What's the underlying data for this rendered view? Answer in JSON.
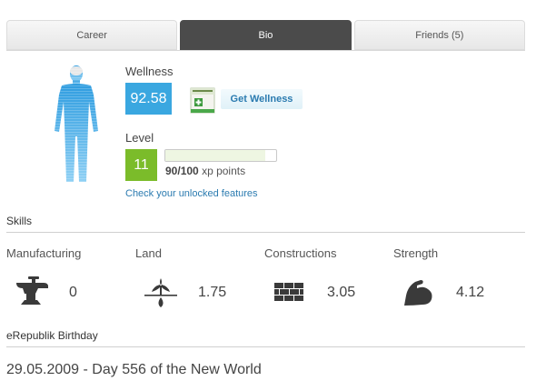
{
  "tabs": [
    "Career",
    "Bio",
    "Friends (5)"
  ],
  "active_tab": "Bio",
  "wellness": {
    "label": "Wellness",
    "value": "92.58",
    "pack_name": "wellness pack",
    "button": "Get Wellness"
  },
  "level": {
    "label": "Level",
    "value": "11",
    "xp_current": "90",
    "xp_separator": "/",
    "xp_max": "100",
    "xp_unit": " xp points",
    "xp_fraction": 0.9,
    "link": "Check your unlocked features"
  },
  "skills": {
    "title": "Skills",
    "items": [
      {
        "name": "Manufacturing",
        "value": "0",
        "icon": "anvil-icon"
      },
      {
        "name": "Land",
        "value": "1.75",
        "icon": "sprout-icon"
      },
      {
        "name": "Constructions",
        "value": "3.05",
        "icon": "bricks-icon"
      },
      {
        "name": "Strength",
        "value": "4.12",
        "icon": "biceps-icon"
      }
    ]
  },
  "birthday": {
    "title": "eRepublik Birthday",
    "text": "29.05.2009 - Day 556 of the New World"
  },
  "colors": {
    "wellness": "#3aa7e0",
    "level": "#7bbc2a",
    "link": "#2b7bb0",
    "active_tab": "#4b4b4b"
  }
}
